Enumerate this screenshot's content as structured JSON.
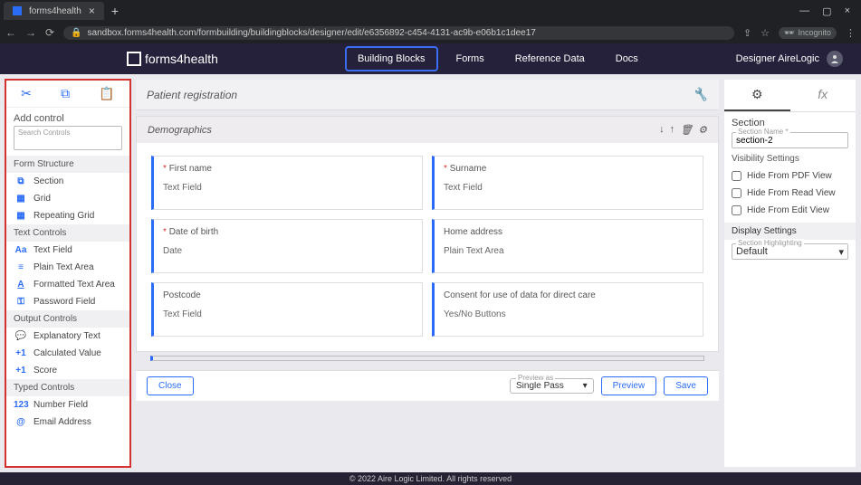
{
  "browser": {
    "tab_title": "forms4health",
    "url": "sandbox.forms4health.com/formbuilding/buildingblocks/designer/edit/e6356892-c454-4131-ac9b-e06b1c1dee17",
    "incognito": "Incognito"
  },
  "header": {
    "brand": "forms4health",
    "nav": {
      "building_blocks": "Building Blocks",
      "forms": "Forms",
      "reference_data": "Reference Data",
      "docs": "Docs"
    },
    "user": "Designer AireLogic"
  },
  "left": {
    "title": "Add control",
    "search_label": "Search Controls",
    "cats": {
      "structure": "Form Structure",
      "text": "Text Controls",
      "output": "Output Controls",
      "typed": "Typed Controls"
    },
    "items": {
      "section": "Section",
      "grid": "Grid",
      "repeating_grid": "Repeating Grid",
      "text_field": "Text Field",
      "plain_text_area": "Plain Text Area",
      "formatted_text_area": "Formatted Text Area",
      "password_field": "Password Field",
      "explanatory_text": "Explanatory Text",
      "calculated_value": "Calculated Value",
      "score": "Score",
      "number_field": "Number Field",
      "email_address": "Email Address"
    }
  },
  "center": {
    "page_title": "Patient registration",
    "section_title": "Demographics",
    "fields": {
      "first_name": {
        "label": "First name",
        "type": "Text Field"
      },
      "surname": {
        "label": "Surname",
        "type": "Text Field"
      },
      "dob": {
        "label": "Date of birth",
        "type": "Date"
      },
      "home_address": {
        "label": "Home address",
        "type": "Plain Text Area"
      },
      "postcode": {
        "label": "Postcode",
        "type": "Text Field"
      },
      "consent": {
        "label": "Consent for use of data for direct care",
        "type": "Yes/No Buttons"
      }
    },
    "close": "Close",
    "preview_as_label": "Preview as",
    "preview_mode": "Single Pass",
    "preview": "Preview",
    "save": "Save"
  },
  "right": {
    "section_header": "Section",
    "section_name_label": "Section Name *",
    "section_name": "section-2",
    "visibility": "Visibility Settings",
    "hide_pdf": "Hide From PDF View",
    "hide_read": "Hide From Read View",
    "hide_edit": "Hide From Edit View",
    "display": "Display Settings",
    "highlight_label": "Section Highlighting",
    "highlight_value": "Default"
  },
  "footer": "© 2022 Aire Logic Limited. All rights reserved"
}
